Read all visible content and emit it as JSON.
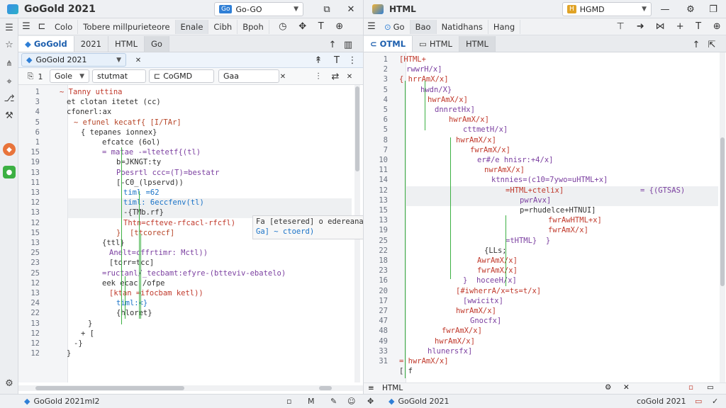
{
  "window": {
    "title": "GoGold 2021"
  },
  "top_right": {
    "combo_left": "Go-GO",
    "combo_left_badge": "Go",
    "file_title": "HTML",
    "combo_right": "HGMD",
    "combo_right_badge": "H"
  },
  "left_toolbar": {
    "buttons": [
      "Colo",
      "Tobere millpurieteore",
      "Enale",
      "Cibh",
      "Bpoh"
    ]
  },
  "right_toolbar": {
    "buttons": [
      "Go",
      "Bao",
      "Natidhans",
      "Hang"
    ]
  },
  "left_tabs": {
    "project": "GoGold",
    "year": "2021",
    "html": "HTML",
    "go": "Go"
  },
  "right_tabs": [
    "OTML",
    "HTML",
    "HTML"
  ],
  "left_breadcrumb": {
    "project": "GoGold 2021"
  },
  "left_filters": {
    "num": "1",
    "go": "Gole",
    "stut": "stutmat",
    "cogmd": "CoGMD",
    "gaa": "Gaa"
  },
  "left_lines": [
    "1",
    "3",
    "4",
    "5",
    "6",
    "1",
    "15",
    "19",
    "13",
    "11",
    "13",
    "12",
    "13",
    "12",
    "15",
    "13",
    "25",
    "23",
    "25",
    "12",
    "13",
    "24",
    "22",
    "13",
    "12",
    "12",
    "12"
  ],
  "left_code": [
    {
      "t": "~ Tanny uttina",
      "c": "#c0392b"
    },
    {
      "t": "et clotan itetet (cc)",
      "c": "#333"
    },
    {
      "t": "cfonerl:ax",
      "c": "#333"
    },
    {
      "t": "~ efunel kecatf{ [I/TAr]",
      "c": "#b7472a"
    },
    {
      "t": "{ tepanes ionnex}",
      "c": "#333"
    },
    {
      "t": "efcatce (6ol)",
      "c": "#333"
    },
    {
      "t": "= matae -=ltetetf{(tl)",
      "c": "#7b3fa0"
    },
    {
      "t": "b=JKNGT:ty",
      "c": "#333"
    },
    {
      "t": "Poesrtl ccc=(T)=bestatr",
      "c": "#7b3fa0"
    },
    {
      "t": "[-C0_(lpservd))",
      "c": "#333"
    },
    {
      "t": "timl =62",
      "c": "#1a73c8"
    },
    {
      "t": "timl: 6eccfenv(tl)",
      "c": "#1a73c8"
    },
    {
      "t": "-{TMb.rf}",
      "c": "#333"
    },
    {
      "t": "Thtn=cfteve-rfcacl-rfcfl)",
      "c": "#c0392b"
    },
    {
      "t": "}  [ttcorecf]",
      "c": "#b7472a"
    },
    {
      "t": "{ttl}",
      "c": "#333"
    },
    {
      "t": "Anelt=cffrtimr: Mctl))",
      "c": "#7b3fa0"
    },
    {
      "t": "[torr=tcc]",
      "c": "#333"
    },
    {
      "t": "=ructanl/_tecbamt:efyre-(btteviv-ebatelo)",
      "c": "#7b3fa0"
    },
    {
      "t": "eek ecac /ofpe",
      "c": "#333"
    },
    {
      "t": "[ktan =ifocbam ketl))",
      "c": "#c0392b"
    },
    {
      "t": "timl:<}",
      "c": "#1a73c8"
    },
    {
      "t": "{hloret}",
      "c": "#333"
    },
    {
      "t": "}",
      "c": "#333"
    },
    {
      "t": "+ [",
      "c": "#333"
    },
    {
      "t": "-}",
      "c": "#333"
    },
    {
      "t": "}",
      "c": "#333"
    }
  ],
  "tooltip": {
    "line1": "Fa [etesered]   o edereanan",
    "line2": "Ga] ~ ctoerd)"
  },
  "right_lines": [
    "1",
    "2",
    "3",
    "5",
    "4",
    "5",
    "6",
    "5",
    "8",
    "7",
    "10",
    "11",
    "14",
    "12",
    "13",
    "15",
    "13",
    "19",
    "25",
    "22",
    "18",
    "23",
    "16",
    "20",
    "17",
    "27",
    "47",
    "48",
    "49",
    "33",
    "31"
  ],
  "right_code": [
    {
      "t": "[HTML+",
      "c": "#c0392b"
    },
    {
      "t": "rwwrH/x]",
      "c": "#7b3fa0"
    },
    {
      "t": "{ hrrAmX/x]",
      "c": "#c0392b"
    },
    {
      "t": "hwdn/X}",
      "c": "#7b3fa0"
    },
    {
      "t": "hwrAmX/x]",
      "c": "#c0392b"
    },
    {
      "t": "dnnretHx]",
      "c": "#7b3fa0"
    },
    {
      "t": "hwrAmX/x]",
      "c": "#c0392b"
    },
    {
      "t": "cttmetH/x]",
      "c": "#7b3fa0"
    },
    {
      "t": "hwrAmX/x]",
      "c": "#c0392b"
    },
    {
      "t": "fwrAmX/x]",
      "c": "#c0392b"
    },
    {
      "t": "er#/e hnisr:+4/x]",
      "c": "#7b3fa0"
    },
    {
      "t": "nwrAmX/x]",
      "c": "#c0392b"
    },
    {
      "t": "ktnnies=(c10=7ywo=uHTML+x]",
      "c": "#7b3fa0"
    },
    {
      "t": "=HTML+ctelix]",
      "c": "#c0392b"
    },
    {
      "t": "pwrAvx]",
      "c": "#7b3fa0"
    },
    {
      "t": "p=rhudelce+HTNUI]",
      "c": "#333"
    },
    {
      "t": "fwrAwHTML+x]",
      "c": "#c0392b"
    },
    {
      "t": "fwrAmX/x]",
      "c": "#c0392b"
    },
    {
      "t": "=tHTML}  }",
      "c": "#7b3fa0"
    },
    {
      "t": "{LLs;",
      "c": "#333"
    },
    {
      "t": "AwrAmX/x]",
      "c": "#c0392b"
    },
    {
      "t": "fwrAmX/x]",
      "c": "#c0392b"
    },
    {
      "t": "}  hoceeH/x]",
      "c": "#7b3fa0"
    },
    {
      "t": "[#iwherrA/x=ts=t/x]",
      "c": "#c0392b"
    },
    {
      "t": "[wwicitx]",
      "c": "#7b3fa0"
    },
    {
      "t": "hwrAmX/x]",
      "c": "#c0392b"
    },
    {
      "t": "Gnocfx]",
      "c": "#7b3fa0"
    },
    {
      "t": "fwrAmX/x]",
      "c": "#c0392b"
    },
    {
      "t": "hwrAmX/x]",
      "c": "#c0392b"
    },
    {
      "t": "hlunersfx]",
      "c": "#7b3fa0"
    },
    {
      "t": "= hwrAmX/x]",
      "c": "#c0392b"
    },
    {
      "t": "[ f",
      "c": "#333"
    }
  ],
  "right_annot": "= {(GTSAS)",
  "status_left": {
    "project": "GoGold 2021mI2",
    "mode": "M"
  },
  "status_right": {
    "lang": "HTML",
    "project": "GoGold 2021",
    "right_text": "coGold 2021"
  }
}
